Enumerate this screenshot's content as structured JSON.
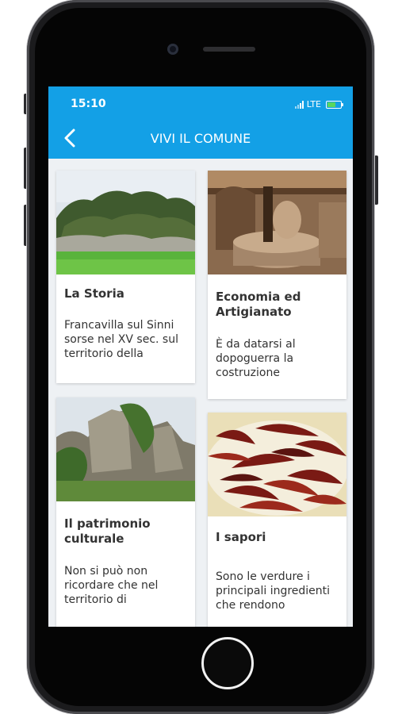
{
  "status_bar": {
    "time": "15:10",
    "network": "LTE",
    "battery_level": 0.7
  },
  "header": {
    "title": "VIVI IL COMUNE",
    "back_icon": "chevron-left-icon"
  },
  "colors": {
    "header": "#13a0e6",
    "background": "#eef1f4",
    "card": "#ffffff",
    "text": "#333333"
  },
  "cards": [
    {
      "title": "La Storia",
      "text": "Francavilla sul Sinni sorse nel XV sec. sul territorio della"
    },
    {
      "title": "Economia ed Artigianato",
      "text": "È da datarsi al dopoguerra la costruzione"
    },
    {
      "title": "Il patrimonio culturale",
      "text": "Non si può non ricordare che nel territorio di"
    },
    {
      "title": "I sapori",
      "text": "Sono le verdure i principali ingredienti che rendono"
    }
  ]
}
